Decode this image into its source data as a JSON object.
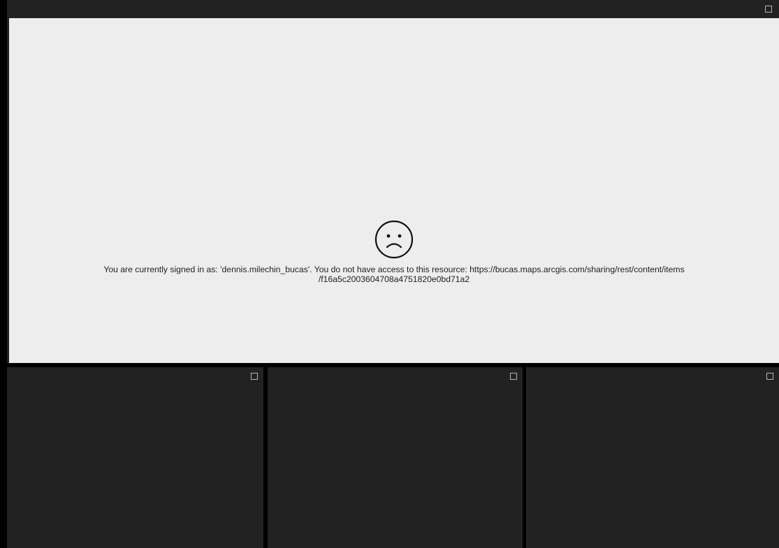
{
  "panels": {
    "top": {
      "maximize_icon": "square-outline-icon",
      "error": {
        "icon": "sad-face-icon",
        "message_line_1": "You are currently signed in as: 'dennis.milechin_bucas'. You do not have access to this resource: https://bucas.maps.arcgis.com/sharing/rest/content/items",
        "message_line_2": "/f16a5c2003604708a4751820e0bd71a2"
      }
    },
    "bottom": [
      {
        "maximize_icon": "square-outline-icon"
      },
      {
        "maximize_icon": "square-outline-icon"
      },
      {
        "maximize_icon": "square-outline-icon"
      }
    ]
  },
  "colors": {
    "background": "#000000",
    "panel": "#222222",
    "content": "#ededed",
    "text": "#1e1e1e",
    "icon": "#b5b5b5"
  }
}
